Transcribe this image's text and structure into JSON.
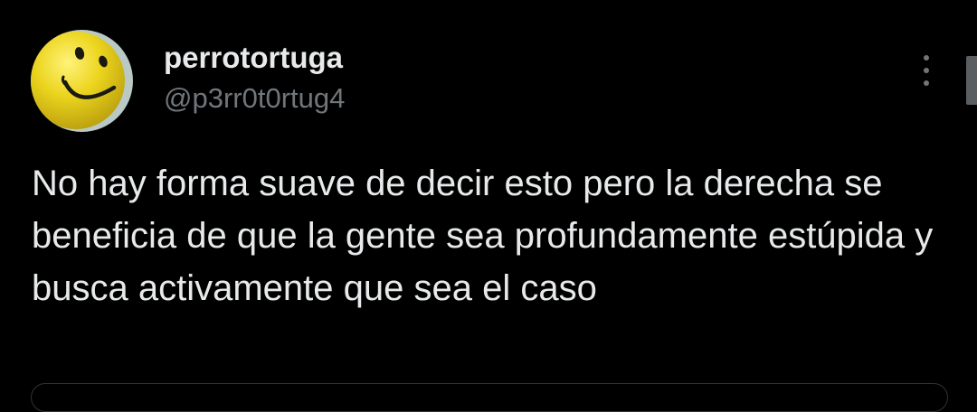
{
  "tweet": {
    "author": {
      "display_name": "perrotortuga",
      "handle": "@p3rr0t0rtug4",
      "avatar_icon": "smiley-face-icon"
    },
    "text": "No hay forma suave de decir esto pero la derecha se beneficia de que la gente sea profundamente estúpida y busca activamente que sea el caso",
    "more_icon": "more-vertical-icon"
  },
  "colors": {
    "background": "#000000",
    "primary_text": "#e7e9ea",
    "secondary_text": "#71767b",
    "avatar_yellow": "#e8d21c",
    "avatar_bg": "#b9c9c6"
  }
}
